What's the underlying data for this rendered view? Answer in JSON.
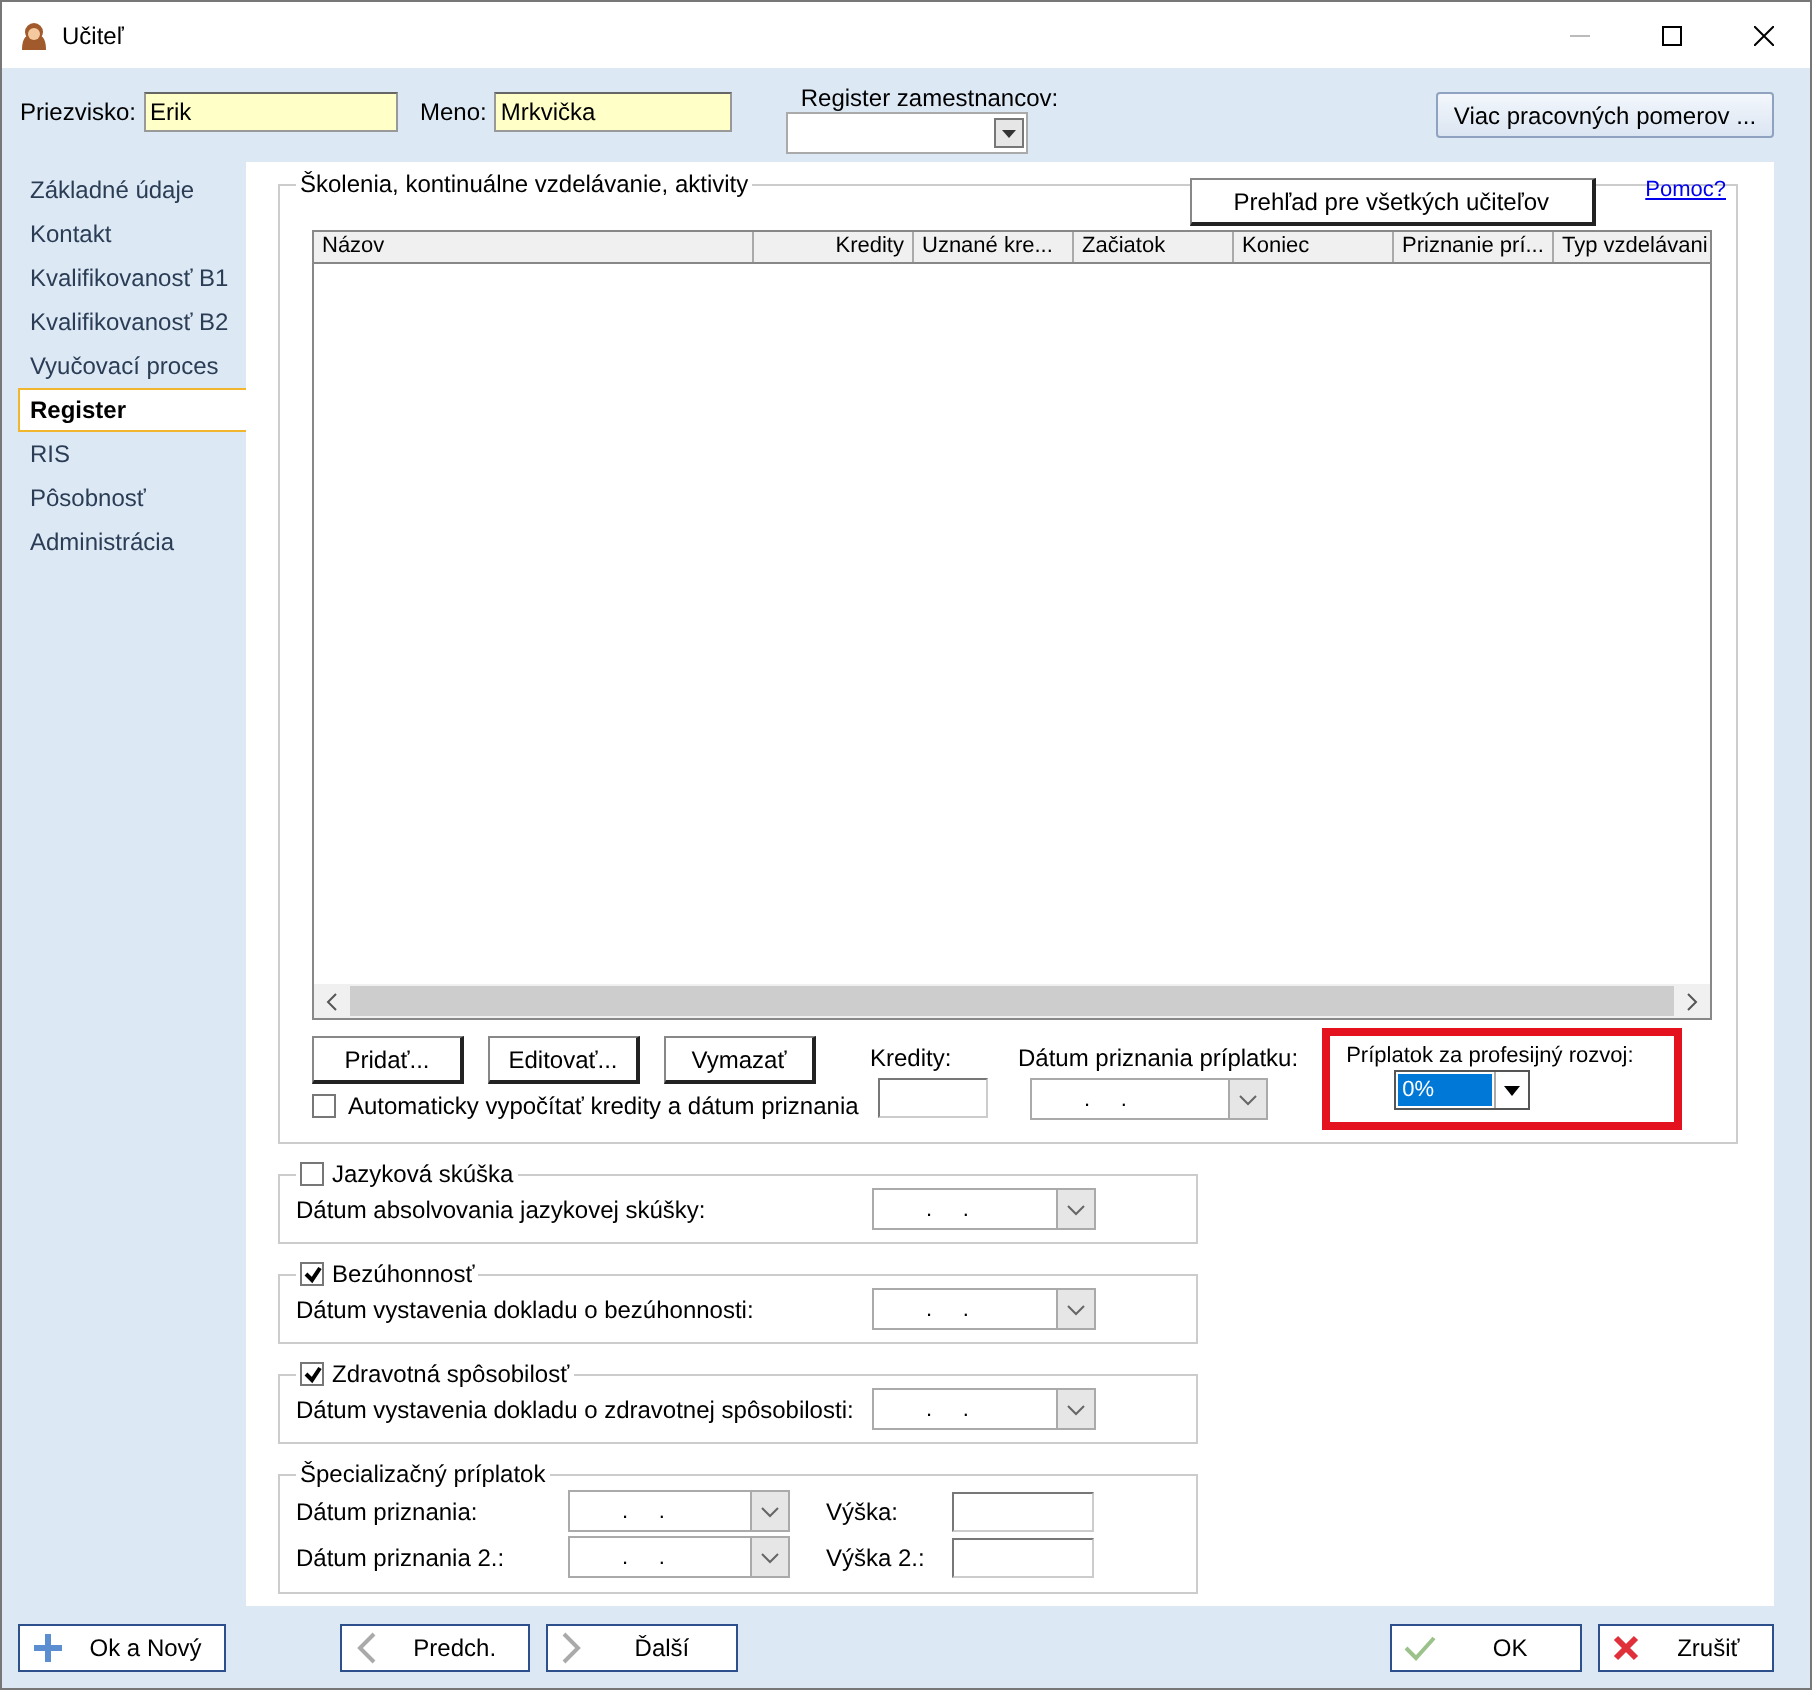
{
  "window": {
    "title": "Učiteľ"
  },
  "header": {
    "surname_label": "Priezvisko:",
    "surname": "Erik",
    "name_label": "Meno:",
    "name": "Mrkvička",
    "register_label": "Register zamestnancov:",
    "more_button": "Viac pracovných pomerov ..."
  },
  "sidebar": {
    "items": [
      {
        "label": "Základné údaje",
        "selected": false
      },
      {
        "label": "Kontakt",
        "selected": false
      },
      {
        "label": "Kvalifikovanosť B1",
        "selected": false
      },
      {
        "label": "Kvalifikovanosť B2",
        "selected": false
      },
      {
        "label": "Vyučovací proces",
        "selected": false
      },
      {
        "label": "Register",
        "selected": true
      },
      {
        "label": "RIS",
        "selected": false
      },
      {
        "label": "Pôsobnosť",
        "selected": false
      },
      {
        "label": "Administrácia",
        "selected": false
      }
    ]
  },
  "trainings": {
    "title": "Školenia, kontinuálne vzdelávanie, aktivity",
    "overview_button": "Prehľad pre všetkých učiteľov",
    "help_link": "Pomoc?",
    "columns": [
      "Názov",
      "Kredity",
      "Uznané kre...",
      "Začiatok",
      "Koniec",
      "Priznanie prí...",
      "Typ vzdelávani"
    ],
    "buttons": [
      "Pridať...",
      "Editovať...",
      "Vymazať"
    ],
    "auto_checkbox": {
      "label": "Automaticky vypočítať kredity a dátum priznania",
      "checked": false
    },
    "credits_label": "Kredity:",
    "date_label": "Dátum priznania príplatku:",
    "date_value": ".     .",
    "allowance": {
      "label": "Príplatok za profesijný rozvoj:",
      "value": "0%",
      "highlighted": true
    }
  },
  "sections": [
    {
      "title": "Jazyková skúška",
      "checked": false,
      "field_label": "Dátum absolvovania jazykovej skúšky:",
      "date_value": ".     ."
    },
    {
      "title": "Bezúhonnosť",
      "checked": true,
      "field_label": "Dátum vystavenia dokladu o bezúhonnosti:",
      "date_value": ".     ."
    },
    {
      "title": "Zdravotná spôsobilosť",
      "checked": true,
      "field_label": "Dátum vystavenia dokladu o zdravotnej spôsobilosti:",
      "date_value": ".     ."
    }
  ],
  "special": {
    "title": "Špecializačný príplatok",
    "rows": [
      {
        "date_label": "Dátum priznania:",
        "date_value": ".     .",
        "amount_label": "Výška:"
      },
      {
        "date_label": "Dátum priznania 2.:",
        "date_value": ".     .",
        "amount_label": "Výška 2.:"
      }
    ]
  },
  "footer": {
    "buttons": [
      {
        "label": "Ok a Nový",
        "kind": "plus"
      },
      {
        "label": "Predch.",
        "kind": "prev"
      },
      {
        "label": "Ďalší",
        "kind": "next"
      },
      {
        "label": "OK",
        "kind": "ok"
      },
      {
        "label": "Zrušiť",
        "kind": "cancel"
      }
    ]
  }
}
